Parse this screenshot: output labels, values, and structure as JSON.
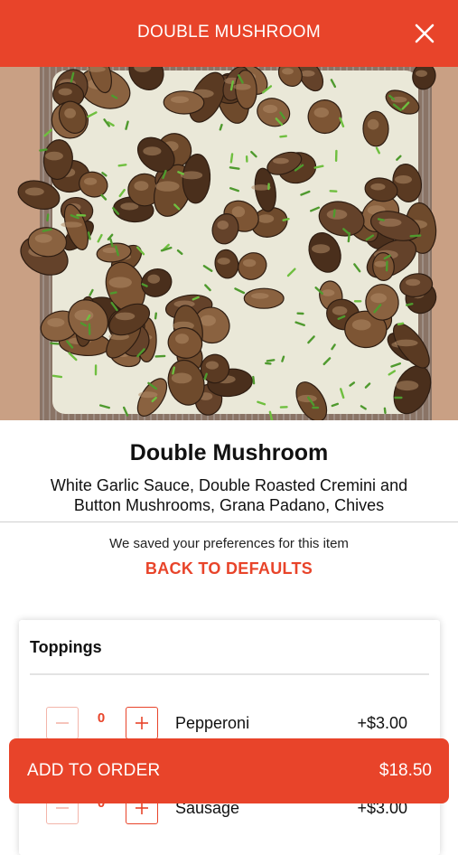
{
  "header": {
    "title": "DOUBLE MUSHROOM"
  },
  "item": {
    "name": "Double Mushroom",
    "description": "White Garlic Sauce, Double Roasted Cremini and Button Mushrooms, Grana Padano, Chives"
  },
  "preferences": {
    "note": "We saved your preferences for this item",
    "reset_label": "BACK TO DEFAULTS"
  },
  "toppings": {
    "title": "Toppings",
    "items": [
      {
        "quantity": "0",
        "name": "Pepperoni",
        "price": "+$3.00"
      },
      {
        "quantity": "0",
        "name": "Sausage",
        "price": "+$3.00"
      }
    ]
  },
  "footer": {
    "add_label": "ADD TO ORDER",
    "total": "$18.50"
  },
  "colors": {
    "brand": "#e8442a"
  }
}
